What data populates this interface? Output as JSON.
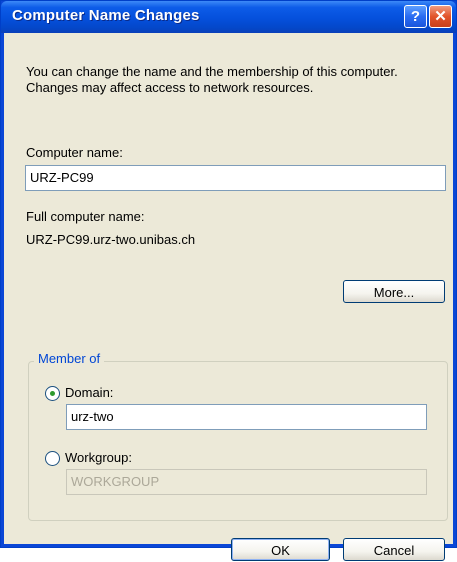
{
  "window": {
    "title": "Computer Name Changes",
    "help_glyph": "?",
    "close_glyph": "✕"
  },
  "description": "You can change the name and the membership of this computer. Changes may affect access to network resources.",
  "computer_name": {
    "label": "Computer name:",
    "value": "URZ-PC99"
  },
  "full_name": {
    "label": "Full computer name:",
    "value": "URZ-PC99.urz-two.unibas.ch"
  },
  "buttons": {
    "more": "More...",
    "ok": "OK",
    "cancel": "Cancel"
  },
  "member_of": {
    "legend": "Member of",
    "domain": {
      "label": "Domain:",
      "value": "urz-two",
      "selected": true
    },
    "workgroup": {
      "label": "Workgroup:",
      "value": "WORKGROUP",
      "selected": false
    }
  },
  "colors": {
    "titlebar": "#0550dc",
    "dialog_bg": "#ece9d8",
    "legend_text": "#0046d5"
  }
}
